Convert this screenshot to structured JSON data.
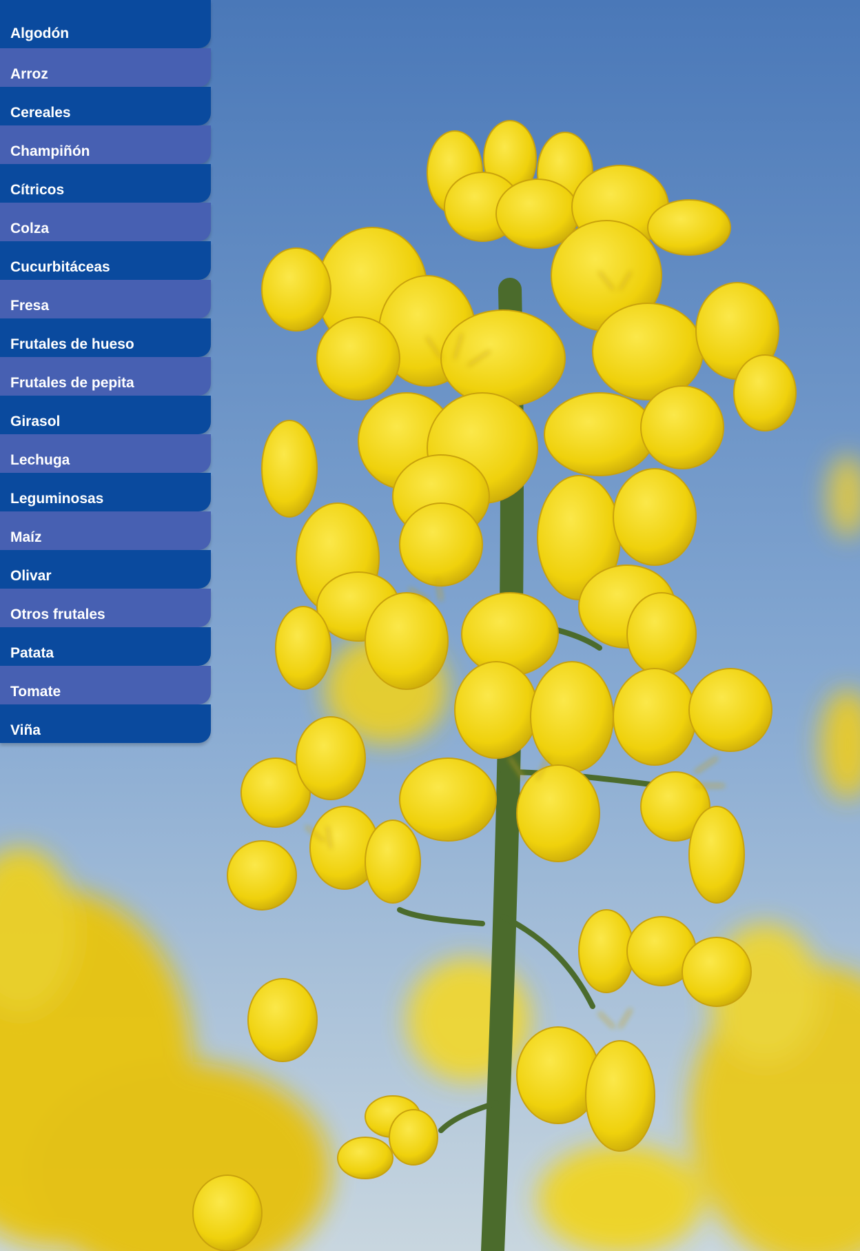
{
  "menu": {
    "items": [
      {
        "label": "Algodón"
      },
      {
        "label": "Arroz"
      },
      {
        "label": "Cereales"
      },
      {
        "label": "Champiñón"
      },
      {
        "label": "Cítricos"
      },
      {
        "label": "Colza"
      },
      {
        "label": "Cucurbitáceas"
      },
      {
        "label": "Fresa"
      },
      {
        "label": "Frutales de hueso"
      },
      {
        "label": "Frutales de pepita"
      },
      {
        "label": "Girasol"
      },
      {
        "label": "Lechuga"
      },
      {
        "label": "Leguminosas"
      },
      {
        "label": "Maíz"
      },
      {
        "label": "Olivar"
      },
      {
        "label": "Otros frutales"
      },
      {
        "label": "Patata"
      },
      {
        "label": "Tomate"
      },
      {
        "label": "Viña"
      }
    ],
    "colors": {
      "dark": "#0a4a9e",
      "light": "#4760b2"
    }
  },
  "background": {
    "subject": "yellow-flower-photo",
    "colors": {
      "sky_top": "#4a78b8",
      "sky_bottom": "#b8cde0",
      "petal": "#f2d90e",
      "stem": "#4b6b2c"
    }
  }
}
